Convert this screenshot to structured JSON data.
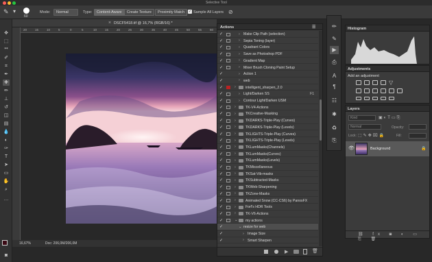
{
  "window": {
    "title": "Selective Tool",
    "traffic_colors": [
      "#fc5f57",
      "#fdbc2e",
      "#28c840"
    ]
  },
  "options_bar": {
    "brush_size": "60",
    "mode_label": "Mode:",
    "mode_value": "Normal",
    "type_label": "Type:",
    "type_buttons": [
      "Content-Aware",
      "Create Texture",
      "Proximity Match"
    ],
    "sample_all_layers": "Sample All Layers"
  },
  "document": {
    "tab_title": "DSCF5418.tif @ 16,7% (RGB/16) *",
    "ruler_ticks": [
      "20",
      "15",
      "10",
      "5",
      "0",
      "5",
      "10",
      "15",
      "20",
      "25",
      "30",
      "35",
      "40",
      "45",
      "50",
      "55",
      "60"
    ],
    "zoom": "16,67%",
    "doc_info": "Doc: 206,0M/206,0M"
  },
  "actions_panel": {
    "title": "Actions",
    "rows": [
      {
        "check": true,
        "box": true,
        "indent": 1,
        "folder": false,
        "name": "Make Clip Path (selection)"
      },
      {
        "check": true,
        "box": true,
        "indent": 1,
        "folder": false,
        "name": "Sepia Toning (layer)"
      },
      {
        "check": true,
        "box": true,
        "indent": 1,
        "folder": false,
        "name": "Quadrant Colors"
      },
      {
        "check": true,
        "box": true,
        "indent": 1,
        "folder": false,
        "name": "Save as Photoshop PDF"
      },
      {
        "check": true,
        "box": true,
        "indent": 1,
        "folder": false,
        "name": "Gradient Map"
      },
      {
        "check": true,
        "box": true,
        "indent": 1,
        "folder": false,
        "name": "Mixer Brush Cloning Paint Setup"
      },
      {
        "check": true,
        "box": false,
        "indent": 1,
        "folder": false,
        "name": "Action 1"
      },
      {
        "check": true,
        "box": false,
        "indent": 1,
        "folder": false,
        "name": "web"
      },
      {
        "check": true,
        "box": true,
        "indent": 0,
        "folder": true,
        "name": "intelligent_sharpen_2.0",
        "red": true
      },
      {
        "check": true,
        "box": true,
        "indent": 1,
        "folder": false,
        "name": "Light/Darken SS",
        "key": "F1"
      },
      {
        "check": true,
        "box": true,
        "indent": 1,
        "folder": false,
        "name": "Contour Light/Darken USM"
      },
      {
        "check": true,
        "box": true,
        "indent": 0,
        "folder": true,
        "name": "TK-V4-Actions"
      },
      {
        "check": true,
        "box": true,
        "indent": 0,
        "folder": true,
        "name": "TKCreative-Masking"
      },
      {
        "check": true,
        "box": true,
        "indent": 0,
        "folder": true,
        "name": "TKDARKS-Triple-Play (Curves)"
      },
      {
        "check": true,
        "box": true,
        "indent": 0,
        "folder": true,
        "name": "TKDARKS-Triple-Play (Levels)"
      },
      {
        "check": true,
        "box": true,
        "indent": 0,
        "folder": true,
        "name": "TKLIGHTS-Triple-Play (Curves)"
      },
      {
        "check": true,
        "box": true,
        "indent": 0,
        "folder": true,
        "name": "TKLIGHTS-Triple-Play (Levels)"
      },
      {
        "check": true,
        "box": true,
        "indent": 0,
        "folder": true,
        "name": "TKLumMasks(Channels)"
      },
      {
        "check": true,
        "box": true,
        "indent": 0,
        "folder": true,
        "name": "TKLumMasks(Curves)"
      },
      {
        "check": true,
        "box": true,
        "indent": 0,
        "folder": true,
        "name": "TKLumMasks(Levels)"
      },
      {
        "check": true,
        "box": true,
        "indent": 0,
        "folder": true,
        "name": "TKMiscellaneous"
      },
      {
        "check": true,
        "box": true,
        "indent": 0,
        "folder": true,
        "name": "TKSat-Vib-masks"
      },
      {
        "check": true,
        "box": true,
        "indent": 0,
        "folder": true,
        "name": "TKSubtracted-Masks"
      },
      {
        "check": true,
        "box": true,
        "indent": 0,
        "folder": true,
        "name": "TKWeb-Sharpening"
      },
      {
        "check": true,
        "box": true,
        "indent": 0,
        "folder": true,
        "name": "TKZone-Masks"
      },
      {
        "check": true,
        "box": true,
        "indent": 0,
        "folder": true,
        "name": "Animated Snow (CC-CS6) by PanosFX"
      },
      {
        "check": true,
        "box": true,
        "indent": 0,
        "folder": true,
        "name": "Forf's HDR Tools"
      },
      {
        "check": true,
        "box": true,
        "indent": 0,
        "folder": true,
        "name": "TK-V6-Actions"
      },
      {
        "check": true,
        "box": true,
        "indent": 0,
        "folder": true,
        "name": "my actions",
        "open": true
      },
      {
        "check": true,
        "box": false,
        "indent": 1,
        "folder": false,
        "name": "resize for web",
        "open": true,
        "selected": true
      },
      {
        "check": true,
        "box": false,
        "indent": 2,
        "folder": false,
        "name": "Image Size"
      },
      {
        "check": true,
        "box": false,
        "indent": 2,
        "folder": false,
        "name": "Smart Sharpen"
      }
    ],
    "footer_icons": [
      "stop-icon",
      "record-icon",
      "play-icon",
      "new-set-icon",
      "new-action-icon",
      "delete-icon"
    ]
  },
  "histogram_panel": {
    "title": "Histogram"
  },
  "adjustments_panel": {
    "title": "Adjustments",
    "subtitle": "Add an adjustment"
  },
  "layers_panel": {
    "title": "Layers",
    "search_placeholder": "Kind",
    "blend_mode": "Normal",
    "opacity_label": "Opacity:",
    "lock_label": "Lock:",
    "fill_label": "Fill:",
    "layers": [
      {
        "name": "Background",
        "visible": true,
        "locked": true
      }
    ]
  }
}
